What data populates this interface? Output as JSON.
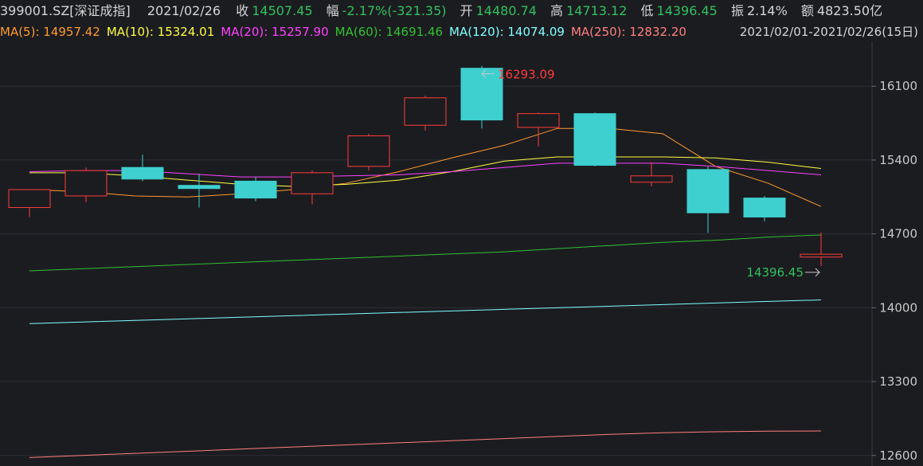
{
  "header": {
    "symbol": "399001.SZ[深证成指]",
    "date": "2021/02/26",
    "close_label": "收",
    "close_value": "14507.45",
    "change_label": "幅",
    "change_value": "-2.17%(-321.35)",
    "open_label": "开",
    "open_value": "14480.74",
    "high_label": "高",
    "high_value": "14713.12",
    "low_label": "低",
    "low_value": "14396.45",
    "amp_label": "振",
    "amp_value": "2.14%",
    "amount_label": "额",
    "amount_value": "4823.50亿"
  },
  "ma_bar": {
    "items": [
      {
        "label": "MA(5): 14957.42",
        "color": "#ff9a2e"
      },
      {
        "label": "MA(10): 15324.01",
        "color": "#ffff40"
      },
      {
        "label": "MA(20): 15257.90",
        "color": "#ff40ff"
      },
      {
        "label": "MA(60): 14691.46",
        "color": "#30c030"
      },
      {
        "label": "MA(120): 14074.09",
        "color": "#7fffff"
      },
      {
        "label": "MA(250): 12832.20",
        "color": "#ff8080"
      }
    ],
    "range": "2021/02/01-2021/02/26(15日)"
  },
  "chart_data": {
    "type": "candlestick",
    "ylim": [
      12500,
      16600
    ],
    "yticks": [
      12600,
      13300,
      14000,
      14700,
      15400,
      16100
    ],
    "max_annotation": {
      "label": "16293.09",
      "value": 16293.09,
      "index": 8
    },
    "min_annotation": {
      "label": "14396.45",
      "value": 14396.45,
      "index": 14
    },
    "candles": [
      {
        "o": 14950,
        "h": 15020,
        "c": 15120,
        "l": 14860
      },
      {
        "o": 15060,
        "h": 15330,
        "c": 15300,
        "l": 15000
      },
      {
        "o": 15330,
        "h": 15450,
        "c": 15220,
        "l": 15200
      },
      {
        "o": 15160,
        "h": 15270,
        "c": 15130,
        "l": 14950
      },
      {
        "o": 15200,
        "h": 15240,
        "c": 15040,
        "l": 15010
      },
      {
        "o": 15080,
        "h": 15300,
        "c": 15280,
        "l": 14980
      },
      {
        "o": 15340,
        "h": 15650,
        "c": 15630,
        "l": 15300
      },
      {
        "o": 15730,
        "h": 16010,
        "c": 15990,
        "l": 15680
      },
      {
        "o": 16270,
        "h": 16293.09,
        "c": 15780,
        "l": 15700
      },
      {
        "o": 15710,
        "h": 15850,
        "c": 15840,
        "l": 15530
      },
      {
        "o": 15840,
        "h": 15850,
        "c": 15350,
        "l": 15340
      },
      {
        "o": 15190,
        "h": 15380,
        "c": 15250,
        "l": 15150
      },
      {
        "o": 15310,
        "h": 15340,
        "c": 14900,
        "l": 14710
      },
      {
        "o": 15040,
        "h": 15060,
        "c": 14860,
        "l": 14820
      },
      {
        "o": 14480.74,
        "h": 14713.12,
        "c": 14507.45,
        "l": 14396.45
      }
    ],
    "ma_lines": [
      {
        "name": "MA(5)",
        "color": "#ff9a2e",
        "values": [
          15120,
          15100,
          15060,
          15050,
          15080,
          15120,
          15180,
          15290,
          15420,
          15540,
          15700,
          15700,
          15650,
          15340,
          15180,
          14960
        ]
      },
      {
        "name": "MA(10)",
        "color": "#ffff40",
        "values": [
          15280,
          15280,
          15250,
          15210,
          15170,
          15150,
          15170,
          15210,
          15290,
          15390,
          15430,
          15430,
          15430,
          15420,
          15380,
          15320
        ]
      },
      {
        "name": "MA(20)",
        "color": "#ff40ff",
        "values": [
          15290,
          15300,
          15300,
          15270,
          15240,
          15240,
          15250,
          15260,
          15290,
          15330,
          15370,
          15370,
          15370,
          15340,
          15300,
          15260
        ]
      },
      {
        "name": "MA(60)",
        "color": "#30c030",
        "values": [
          14350,
          14370,
          14390,
          14410,
          14430,
          14450,
          14470,
          14490,
          14510,
          14530,
          14560,
          14590,
          14620,
          14640,
          14670,
          14690
        ]
      },
      {
        "name": "MA(120)",
        "color": "#7fffff",
        "values": [
          13850,
          13865,
          13880,
          13895,
          13910,
          13925,
          13940,
          13955,
          13970,
          13985,
          14000,
          14015,
          14030,
          14045,
          14060,
          14074
        ]
      },
      {
        "name": "MA(250)",
        "color": "#ff8080",
        "values": [
          12580,
          12600,
          12620,
          12640,
          12660,
          12680,
          12700,
          12720,
          12740,
          12760,
          12780,
          12800,
          12815,
          12825,
          12830,
          12832
        ]
      }
    ]
  }
}
